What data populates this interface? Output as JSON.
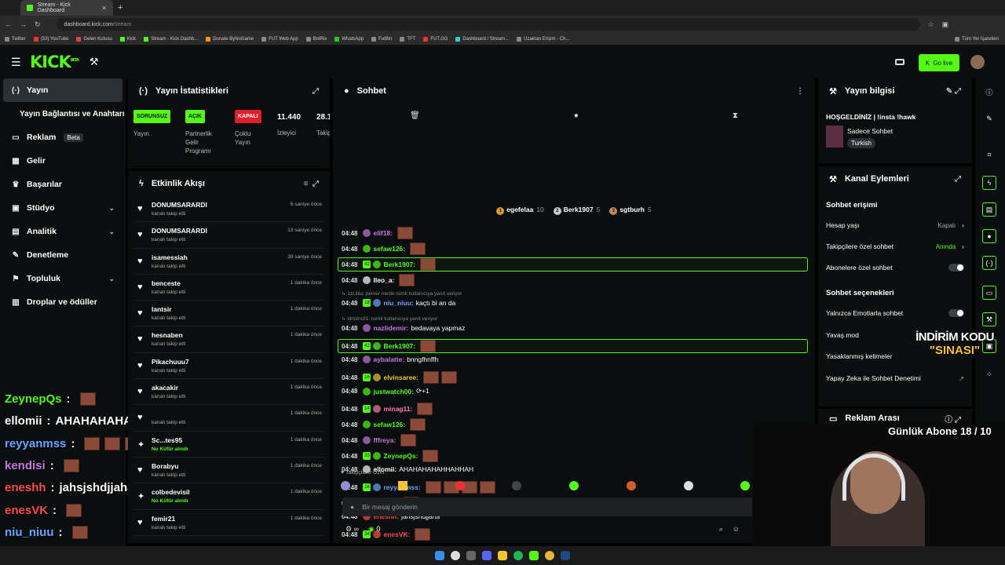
{
  "browser": {
    "tab_title": "Stream - Kick Dashboard",
    "url_host": "dashboard.kick.com",
    "url_path": "/stream",
    "bookmarks": [
      "Twitter",
      "(53) YouTube",
      "Gelen Kutusu",
      "Kick",
      "Stream - Kick Dashb...",
      "Donate ByNoGame",
      "FUT Web App",
      "BotRix",
      "WhatsApp",
      "FutBin",
      "TFT",
      "FUT.GG",
      "Dashboard / Stream...",
      "Uzaktan Erişim - Ch..."
    ],
    "all_bookmarks": "Tüm Yer İşaretleri"
  },
  "header": {
    "logo": "KICK",
    "logo_sup": "BETA",
    "go_live": "Go live",
    "accent": "#53fc18"
  },
  "nav": [
    {
      "label": "Yayın",
      "icon": "broadcast-icon",
      "glyph": "(·)"
    },
    {
      "label": "Yayın Bağlantısı ve Anahtarı"
    },
    {
      "label": "Reklam",
      "icon": "tv-icon",
      "glyph": "▭",
      "beta": "Beta"
    },
    {
      "label": "Gelir",
      "icon": "chart-icon",
      "glyph": "▦"
    },
    {
      "label": "Başarılar",
      "icon": "trophy-icon",
      "glyph": "♛"
    },
    {
      "label": "Stüdyo",
      "icon": "studio-icon",
      "glyph": "▣"
    },
    {
      "label": "Analitik",
      "icon": "analytics-icon",
      "glyph": "▤"
    },
    {
      "label": "Denetleme",
      "icon": "moderation-icon",
      "glyph": "✎"
    },
    {
      "label": "Topluluk",
      "icon": "community-icon",
      "glyph": "⚑"
    },
    {
      "label": "Droplar ve ödüller",
      "icon": "drops-icon",
      "glyph": "▥"
    }
  ],
  "stats": {
    "title": "Yayın İstatistikleri",
    "cols": [
      {
        "badge": "SORUNSUZ",
        "label": "Yayın"
      },
      {
        "badge": "AÇIK",
        "label": "Partnerlik Gelir Programı"
      },
      {
        "badge": "KAPALI",
        "label": "Çoklu Yayın"
      },
      {
        "value": "11.440",
        "label": "İzleyici"
      },
      {
        "value": "28.1",
        "label": "Takip"
      }
    ]
  },
  "activity": {
    "title": "Etkinlik Akışı",
    "items": [
      {
        "name": "DONUMSARARDI",
        "sub": "kanalı takip etti",
        "time": "6 saniye önce"
      },
      {
        "name": "DONUMSARARDI",
        "sub": "kanalı takip etti",
        "time": "13 saniye önce"
      },
      {
        "name": "isamessiah",
        "sub": "kanalı takip etti",
        "time": "39 saniye önce"
      },
      {
        "name": "benceste",
        "sub": "kanalı takip etti",
        "time": "1 dakika önce"
      },
      {
        "name": "lantsir",
        "sub": "kanalı takip etti",
        "time": "1 dakika önce"
      },
      {
        "name": "hesnaben",
        "sub": "kanalı takip etti",
        "time": "1 dakika önce"
      },
      {
        "name": "Pikachuuu7",
        "sub": "kanalı takip etti",
        "time": "1 dakika önce"
      },
      {
        "name": "akacakir",
        "sub": "kanalı takip etti",
        "time": "1 dakika önce"
      },
      {
        "name": "",
        "sub": "kanalı takip etti",
        "time": "1 dakika önce"
      },
      {
        "name": "Sc...tes95",
        "sub": "No Küfür alındı",
        "time": "1 dakika önce",
        "reward": true
      },
      {
        "name": "Borabyu",
        "sub": "kanalı takip etti",
        "time": "1 dakika önce"
      },
      {
        "name": "colbedevisil",
        "sub": "No Küfür alındı",
        "time": "1 dakika önce",
        "reward": true
      },
      {
        "name": "femir21",
        "sub": "kanalı takip etti",
        "time": "1 dakika önce"
      }
    ]
  },
  "chat": {
    "title": "Sohbet",
    "top_gifters": [
      {
        "rank": "1",
        "name": "egefelaa",
        "count": "10",
        "color": "#d99b2a"
      },
      {
        "rank": "2",
        "name": "Berk1907",
        "count": "5",
        "color": "#c7ccd1"
      },
      {
        "rank": "3",
        "name": "sgtburh",
        "count": "5",
        "color": "#c98a5a"
      }
    ],
    "messages": [
      {
        "time": "04:48",
        "user": "elif18:",
        "color": "#c678dd",
        "text": "",
        "emotes": 1
      },
      {
        "time": "04:48",
        "user": "sefaw126:",
        "color": "#53fc18",
        "text": "",
        "emotes": 1
      },
      {
        "time": "04:48",
        "user": "Berk1907:",
        "color": "#53fc18",
        "text": "",
        "emotes": 1,
        "highlight": true,
        "sub": "42"
      },
      {
        "time": "04:48",
        "user": "lleo_a:",
        "color": "#ffffff",
        "text": "",
        "emotes": 1
      },
      {
        "reply": "11Lilila: perver nerde isimli kullanıcıya yanıt veriyor"
      },
      {
        "time": "04:48",
        "user": "niu_niuu:",
        "color": "#6aa6ff",
        "text": "kaçtı bi an da",
        "sub": "18"
      },
      {
        "reply": "idristncil1: isimli kullanıcıya yanıt veriyor"
      },
      {
        "time": "04:48",
        "user": "nazlidemir:",
        "color": "#c678dd",
        "text": "bedavaya yapmaz"
      },
      {
        "time": "04:48",
        "user": "Berk1907:",
        "color": "#53fc18",
        "text": "",
        "emotes": 1,
        "highlight": true,
        "sub": "42"
      },
      {
        "time": "04:48",
        "user": "aybalatte:",
        "color": "#c678dd",
        "text": "bnngfhnffh"
      },
      {
        "time": "04:48",
        "user": "elvinsaree:",
        "color": "#f4c430",
        "text": "",
        "emotes": 2,
        "sub": "16"
      },
      {
        "time": "04:48",
        "user": "justwatch00:",
        "color": "#53fc18",
        "text": "⟳+1"
      },
      {
        "time": "04:48",
        "user": "minag11:",
        "color": "#ff7aa8",
        "text": "",
        "emotes": 1,
        "sub": "14"
      },
      {
        "time": "04:48",
        "user": "sefaw126:",
        "color": "#53fc18",
        "text": "",
        "emotes": 1
      },
      {
        "time": "04:48",
        "user": "fffreya:",
        "color": "#c678dd",
        "text": "",
        "emotes": 1
      },
      {
        "time": "04:48",
        "user": "ZeynepQs:",
        "color": "#53fc18",
        "text": "",
        "emotes": 1,
        "sub": "33"
      },
      {
        "time": "04:48",
        "user": "ellomii:",
        "color": "#ffffff",
        "text": "AHAHAHAHAHHAHHAH"
      },
      {
        "time": "04:48",
        "user": "reyyanmss:",
        "color": "#6aa6ff",
        "text": "",
        "emotes": 4,
        "sub": "16"
      },
      {
        "time": "04:48",
        "user": "kendisi:",
        "color": "#c678dd",
        "text": "",
        "emotes": 1
      },
      {
        "time": "04:48",
        "user": "eneshh:",
        "color": "#ff4d4d",
        "text": "jahsjshdjjaha"
      },
      {
        "time": "04:48",
        "user": "enesVK:",
        "color": "#ff4d4d",
        "text": "",
        "emotes": 1,
        "sub": "34"
      }
    ],
    "followers_only": "Takipçilere Özel",
    "input_placeholder": "Bir mesaj gönderin",
    "points": "0"
  },
  "stream_info": {
    "title": "Yayın bilgisi",
    "stream_title": "HOŞGELDİNİZ | !insta !hawk",
    "category": "Sadece Sohbet",
    "language": "Turkish"
  },
  "channel_actions": {
    "title": "Kanal Eylemleri",
    "chat_access": "Sohbet erişimi",
    "account_age": {
      "label": "Hesap yaşı",
      "value": "Kapalı"
    },
    "followers_only": {
      "label": "Takipçilere özel sohbet",
      "value": "Anında"
    },
    "subs_only": {
      "label": "Abonelere özel sohbet"
    },
    "chat_options": "Sohbet seçenekleri",
    "emotes_only": {
      "label": "Yalnızca Emotlarla sohbet"
    },
    "slow_mode": {
      "label": "Yavaş mod"
    },
    "banned_words": {
      "label": "Yasaklanmış kelimeler"
    },
    "ai_moderation": {
      "label": "Yapay Zeka ile Sohbet Denetimi"
    }
  },
  "ad_break": {
    "title": "Reklam Arası"
  },
  "overlay": {
    "chat": [
      {
        "user": "ZeynepQs",
        "color": "#53fc18",
        "text": "",
        "emotes": 1
      },
      {
        "user": "ellomii",
        "color": "#ffffff",
        "text": "AHAHAHAHAHHAHHAH",
        "emotes": 0
      },
      {
        "user": "reyyanmss",
        "color": "#6aa6ff",
        "text": "",
        "emotes": 3
      },
      {
        "user": "kendisi",
        "color": "#c678dd",
        "text": "",
        "emotes": 1
      },
      {
        "user": "eneshh",
        "color": "#ff4d4d",
        "text": "jahsjshdjjaha",
        "emotes": 0
      },
      {
        "user": "enesVK",
        "color": "#ff4d4d",
        "text": "",
        "emotes": 1
      },
      {
        "user": "niu_niuu",
        "color": "#6aa6ff",
        "text": "",
        "emotes": 1
      }
    ],
    "sub_goal": "Günlük Abone 18 / 10",
    "promo_line1": "İNDİRİM KODU",
    "promo_line2": "\"SINASI\""
  }
}
